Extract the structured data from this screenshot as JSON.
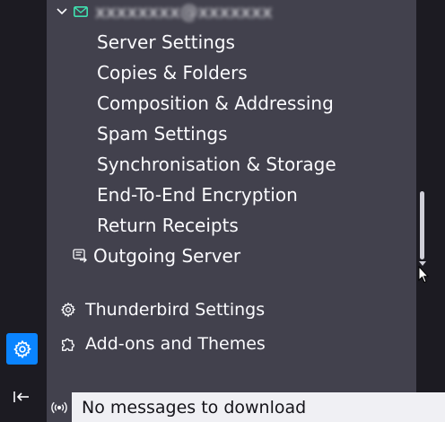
{
  "account": {
    "name": "xxxxxxxx@xxxxxxx",
    "icon": "mail-account-icon"
  },
  "settings_items": [
    {
      "label": "Server Settings"
    },
    {
      "label": "Copies & Folders"
    },
    {
      "label": "Composition & Addressing"
    },
    {
      "label": "Spam Settings"
    },
    {
      "label": "Synchronisation & Storage"
    },
    {
      "label": "End-To-End Encryption"
    },
    {
      "label": "Return Receipts"
    }
  ],
  "outgoing_server": {
    "label": "Outgoing Server",
    "icon": "outgoing-server-icon"
  },
  "global": {
    "thunderbird_settings": {
      "label": "Thunderbird Settings",
      "icon": "gear-icon"
    },
    "addons_themes": {
      "label": "Add-ons and Themes",
      "icon": "puzzle-icon"
    }
  },
  "status_bar": {
    "text": "No messages to download",
    "icon": "online-status-icon"
  },
  "colors": {
    "accent": "#0a84ff",
    "pane_bg": "#42414d",
    "toolbar_bg": "#1c1b22",
    "status_bg": "#f0f0f4",
    "account_icon_green": "#3fe1b0"
  }
}
